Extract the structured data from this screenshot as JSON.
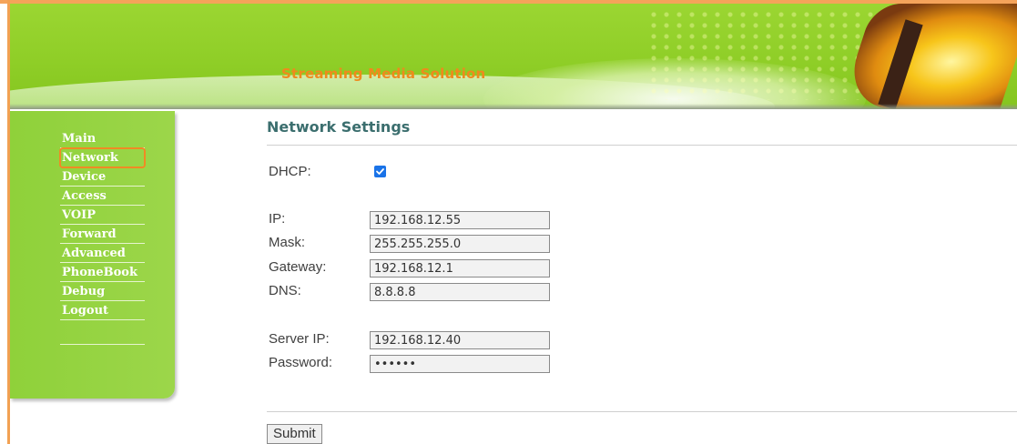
{
  "banner": {
    "title": "Streaming Media Solution"
  },
  "sidebar": {
    "items": [
      {
        "label": "Main"
      },
      {
        "label": "Network"
      },
      {
        "label": "Device"
      },
      {
        "label": "Access"
      },
      {
        "label": "VOIP"
      },
      {
        "label": "Forward"
      },
      {
        "label": "Advanced"
      },
      {
        "label": "PhoneBook"
      },
      {
        "label": "Debug"
      },
      {
        "label": "Logout"
      }
    ],
    "active": "Network"
  },
  "main": {
    "title": "Network Settings",
    "dhcp": {
      "label": "DHCP:",
      "checked": true
    },
    "ip": {
      "label": "IP:",
      "value": "192.168.12.55"
    },
    "mask": {
      "label": "Mask:",
      "value": "255.255.255.0"
    },
    "gateway": {
      "label": "Gateway:",
      "value": "192.168.12.1"
    },
    "dns": {
      "label": "DNS:",
      "value": "8.8.8.8"
    },
    "server_ip": {
      "label": "Server IP:",
      "value": "192.168.12.40"
    },
    "password": {
      "label": "Password:",
      "value": "••••••"
    },
    "submit_label": "Submit"
  },
  "colors": {
    "accent_orange": "#ef8a1c",
    "sidebar_green": "#8fd13a",
    "title_teal": "#3b6e6e",
    "checkbox_blue": "#1a73e8"
  }
}
